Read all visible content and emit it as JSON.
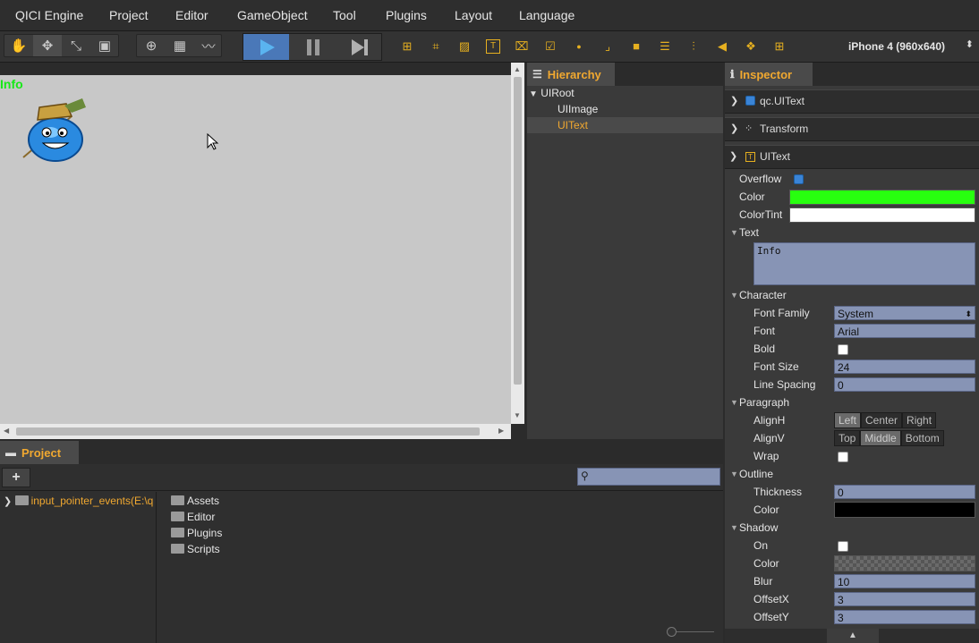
{
  "menu": [
    "QICI Engine",
    "Project",
    "Editor",
    "GameObject",
    "Tool",
    "Plugins",
    "Layout",
    "Language"
  ],
  "device": {
    "label": "iPhone 4 (960x640)"
  },
  "scene": {
    "info_text": "Info"
  },
  "hierarchy": {
    "tab": "Hierarchy",
    "nodes": [
      {
        "label": "UIRoot",
        "selected": false
      },
      {
        "label": "UIImage",
        "selected": false
      },
      {
        "label": "UIText",
        "selected": true
      }
    ]
  },
  "inspector": {
    "tab": "Inspector",
    "components": [
      {
        "label": "qc.UIText"
      },
      {
        "label": "Transform"
      },
      {
        "label": "UIText"
      }
    ],
    "overflow": {
      "label": "Overflow",
      "checked": true
    },
    "color": {
      "label": "Color",
      "value": "#28ff0f"
    },
    "color_tint": {
      "label": "ColorTint",
      "value": "#ffffff"
    },
    "text_section": "Text",
    "text_value": "Info",
    "character": {
      "section": "Character",
      "font_family": {
        "label": "Font Family",
        "value": "System"
      },
      "font": {
        "label": "Font",
        "value": "Arial"
      },
      "bold": {
        "label": "Bold",
        "checked": false
      },
      "font_size": {
        "label": "Font Size",
        "value": "24"
      },
      "line_spacing": {
        "label": "Line Spacing",
        "value": "0"
      }
    },
    "paragraph": {
      "section": "Paragraph",
      "align_h": {
        "label": "AlignH",
        "options": [
          "Left",
          "Center",
          "Right"
        ],
        "selected": "Left"
      },
      "align_v": {
        "label": "AlignV",
        "options": [
          "Top",
          "Middle",
          "Bottom"
        ],
        "selected": "Middle"
      },
      "wrap": {
        "label": "Wrap",
        "checked": false
      }
    },
    "outline": {
      "section": "Outline",
      "thickness": {
        "label": "Thickness",
        "value": "0"
      },
      "color": {
        "label": "Color",
        "value": "#000000"
      }
    },
    "shadow": {
      "section": "Shadow",
      "on": {
        "label": "On",
        "checked": false
      },
      "color": {
        "label": "Color"
      },
      "blur": {
        "label": "Blur",
        "value": "10"
      },
      "offset_x": {
        "label": "OffsetX",
        "value": "3"
      },
      "offset_y": {
        "label": "OffsetY",
        "value": "3"
      }
    }
  },
  "project": {
    "tab": "Project",
    "add_label": "+",
    "search_placeholder": "",
    "root": "input_pointer_events(E:\\q",
    "folders": [
      "Assets",
      "Editor",
      "Plugins",
      "Scripts"
    ]
  },
  "colors": {
    "accent": "#f0a830",
    "bg": "#2b2b2b",
    "input": "#8794b5",
    "info_text": "#18e818"
  }
}
